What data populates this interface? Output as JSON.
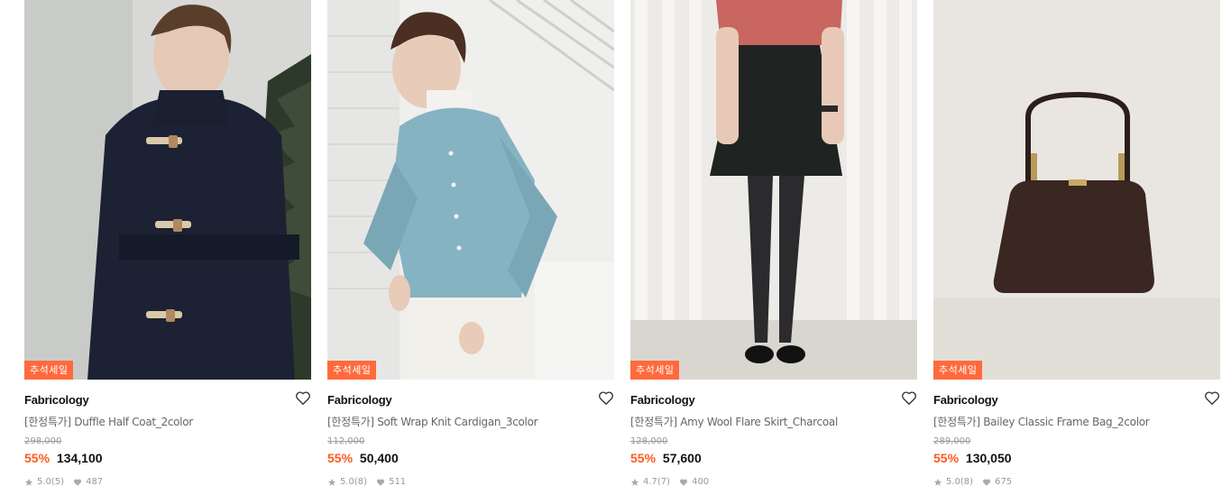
{
  "colors": {
    "badge": "#ff6a3d",
    "discount": "#ff5a1f",
    "text": "#111111",
    "muted": "#999999"
  },
  "products": [
    {
      "badge": "추석세일",
      "brand": "Fabricology",
      "name": "[한정특가] Duffle Half Coat_2color",
      "original_price": "298,000",
      "discount": "55%",
      "price": "134,100",
      "rating": "5.0",
      "reviews": "(5)",
      "likes": "487",
      "image": "model-in-navy-duffle-coat"
    },
    {
      "badge": "추석세일",
      "brand": "Fabricology",
      "name": "[한정특가] Soft Wrap Knit Cardigan_3color",
      "original_price": "112,000",
      "discount": "55%",
      "price": "50,400",
      "rating": "5.0",
      "reviews": "(8)",
      "likes": "511",
      "image": "model-in-light-blue-cardigan"
    },
    {
      "badge": "추석세일",
      "brand": "Fabricology",
      "name": "[한정특가] Amy Wool Flare Skirt_Charcoal",
      "original_price": "128,000",
      "discount": "55%",
      "price": "57,600",
      "rating": "4.7",
      "reviews": "(7)",
      "likes": "400",
      "image": "model-in-charcoal-flare-skirt"
    },
    {
      "badge": "추석세일",
      "brand": "Fabricology",
      "name": "[한정특가] Bailey Classic Frame Bag_2color",
      "original_price": "289,000",
      "discount": "55%",
      "price": "130,050",
      "rating": "5.0",
      "reviews": "(8)",
      "likes": "675",
      "image": "brown-frame-handbag"
    }
  ]
}
